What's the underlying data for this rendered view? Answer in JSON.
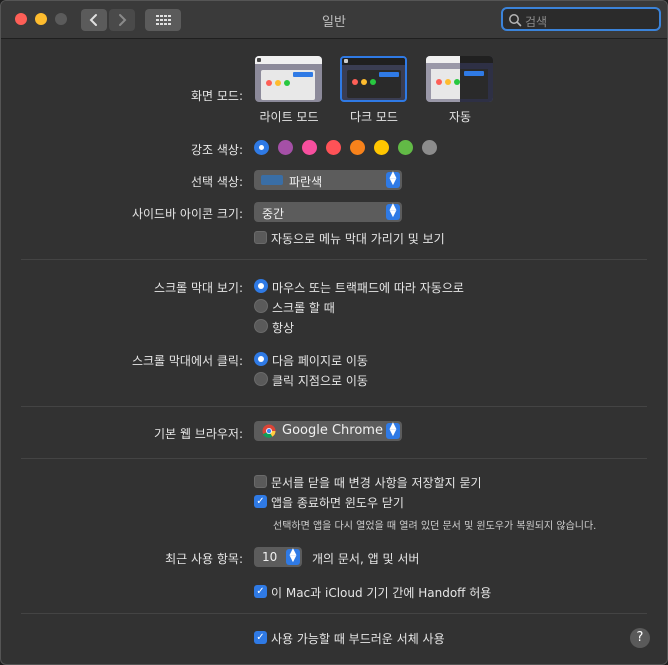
{
  "window": {
    "title": "일반"
  },
  "search": {
    "placeholder": "검색"
  },
  "colors": {
    "accent_blue": "#2f7ae5",
    "accents": [
      "#2f7ae5",
      "#a550a7",
      "#f74f9e",
      "#ff5257",
      "#f7821b",
      "#ffc600",
      "#62ba46",
      "#8c8c8c"
    ]
  },
  "appearance": {
    "label": "화면 모드:",
    "options": [
      "라이트 모드",
      "다크 모드",
      "자동"
    ],
    "selected": "다크 모드"
  },
  "accent_color": {
    "label": "강조 색상:"
  },
  "highlight_color": {
    "label": "선택 색상:",
    "value": "파란색"
  },
  "sidebar_icon_size": {
    "label": "사이드바 아이콘 크기:",
    "value": "중간"
  },
  "auto_hide_menu": {
    "label": "자동으로 메뉴 막대 가리기 및 보기",
    "checked": false
  },
  "show_scroll_bars": {
    "label": "스크롤 막대 보기:",
    "options": [
      "마우스 또는 트랙패드에 따라 자동으로",
      "스크롤 할 때",
      "항상"
    ],
    "selected": 0
  },
  "click_scroll_bar": {
    "label": "스크롤 막대에서 클릭:",
    "options": [
      "다음 페이지로 이동",
      "클릭 지점으로 이동"
    ],
    "selected": 0
  },
  "default_browser": {
    "label": "기본 웹 브라우저:",
    "value": "Google Chrome"
  },
  "ask_keep_changes": {
    "label": "문서를 닫을 때 변경 사항을 저장할지 묻기",
    "checked": false
  },
  "close_windows": {
    "label": "앱을 종료하면 윈도우 닫기",
    "checked": true,
    "note": "선택하면 앱을 다시 열었을 때 열려 있던 문서 및 윈도우가 복원되지 않습니다."
  },
  "recent_items": {
    "label": "최근 사용 항목:",
    "value": "10",
    "suffix": "개의 문서, 앱 및 서버"
  },
  "handoff": {
    "label": "이 Mac과 iCloud 기기 간에 Handoff 허용",
    "checked": true
  },
  "font_smoothing": {
    "label": "사용 가능할 때 부드러운 서체 사용",
    "checked": true
  },
  "help": {
    "label": "?"
  }
}
